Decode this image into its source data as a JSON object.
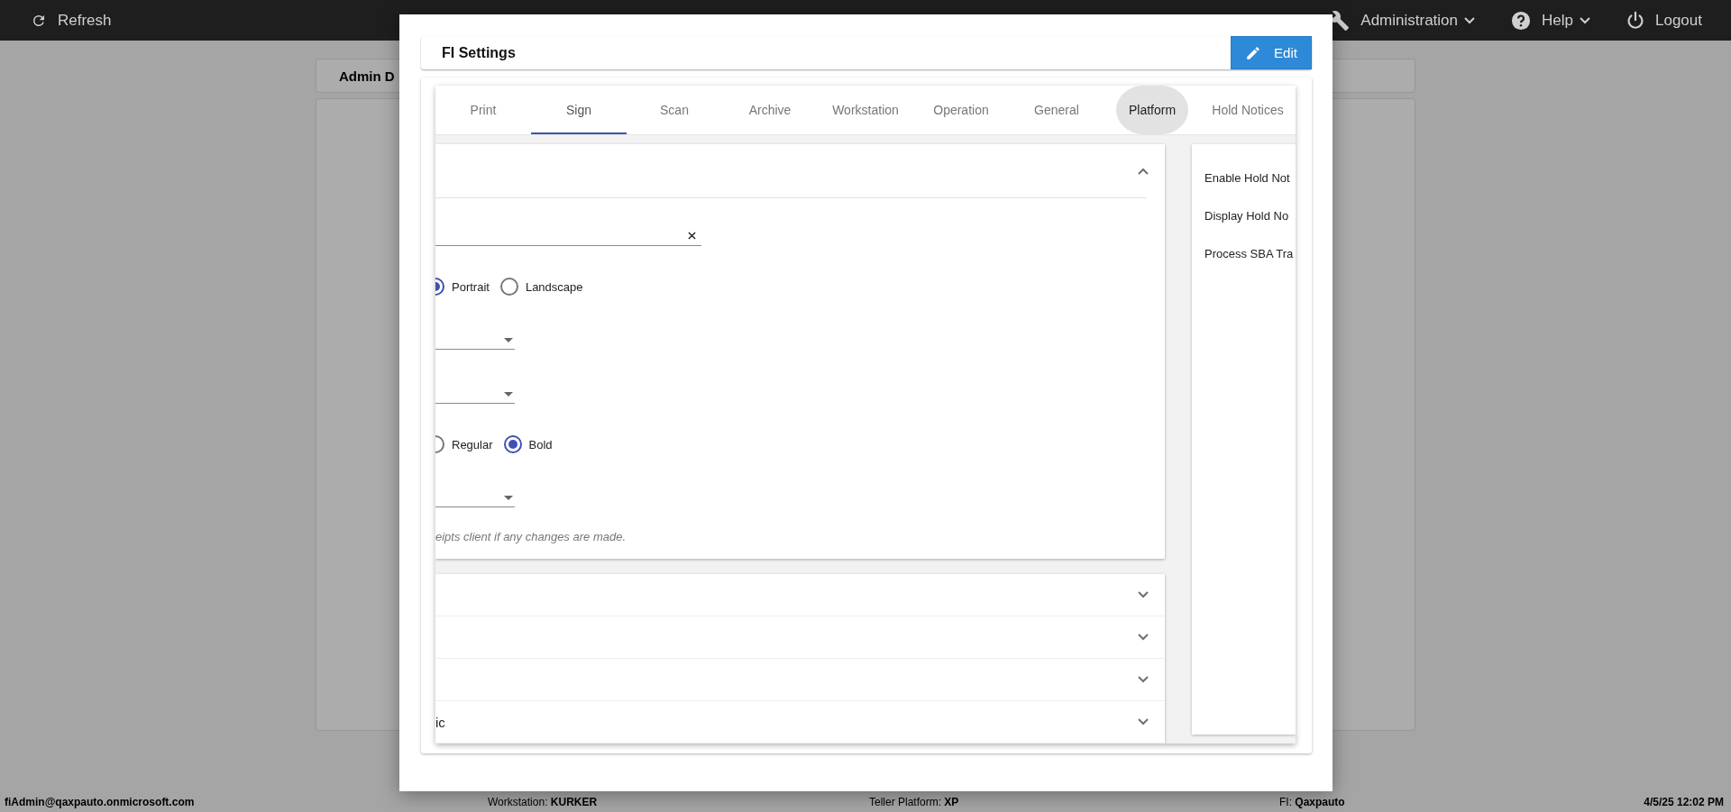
{
  "top_bar": {
    "left": [
      {
        "kind": "refresh",
        "label": "Refresh"
      }
    ],
    "right": [
      {
        "kind": "wrench",
        "label": "Administration",
        "dropdown": true
      },
      {
        "kind": "help",
        "label": "Help",
        "dropdown": true
      },
      {
        "kind": "power",
        "label": "Logout",
        "dropdown": false
      }
    ]
  },
  "background": {
    "card_title": "Admin D"
  },
  "modal": {
    "title": "FI Settings",
    "edit_button": "Edit",
    "tabs": [
      {
        "label": "Print",
        "selected": false,
        "highlighted": false
      },
      {
        "label": "Sign",
        "selected": true,
        "highlighted": false
      },
      {
        "label": "Scan",
        "selected": false,
        "highlighted": false
      },
      {
        "label": "Archive",
        "selected": false,
        "highlighted": false
      },
      {
        "label": "Workstation",
        "selected": false,
        "highlighted": false
      },
      {
        "label": "Operation",
        "selected": false,
        "highlighted": false
      },
      {
        "label": "General",
        "selected": false,
        "highlighted": false
      },
      {
        "label": "Platform",
        "selected": false,
        "highlighted": true
      },
      {
        "label": "Hold Notices",
        "selected": false,
        "highlighted": false
      }
    ],
    "panels": [
      {
        "expanded": true,
        "fields": [
          {
            "kind": "text_field",
            "clearable": true
          },
          {
            "kind": "radio_group",
            "options": [
              {
                "label": "Portrait",
                "selected": true
              },
              {
                "label": "Landscape",
                "selected": false
              }
            ]
          },
          {
            "kind": "select"
          },
          {
            "kind": "select"
          },
          {
            "kind": "radio_group",
            "options": [
              {
                "label": "Regular",
                "selected": false
              },
              {
                "label": "Bold",
                "selected": true
              }
            ]
          },
          {
            "kind": "select"
          },
          {
            "kind": "note",
            "text": "eipts client if any changes are made."
          }
        ]
      },
      {
        "expanded": false
      },
      {
        "expanded": false
      },
      {
        "expanded": false
      },
      {
        "expanded": false,
        "title": "ic"
      }
    ],
    "side_card": {
      "items": [
        "Enable Hold Not",
        "Display Hold No",
        "Process SBA Tra"
      ]
    }
  },
  "status_bar": {
    "user": "fiAdmin@qaxpauto.onmicrosoft.com",
    "workstation": "Workstation: **KURKER**",
    "platform": "Teller Platform: **XP**",
    "fi": "FI: **Qaxpauto**",
    "datetime": "4/5/25 12:02 PM"
  }
}
